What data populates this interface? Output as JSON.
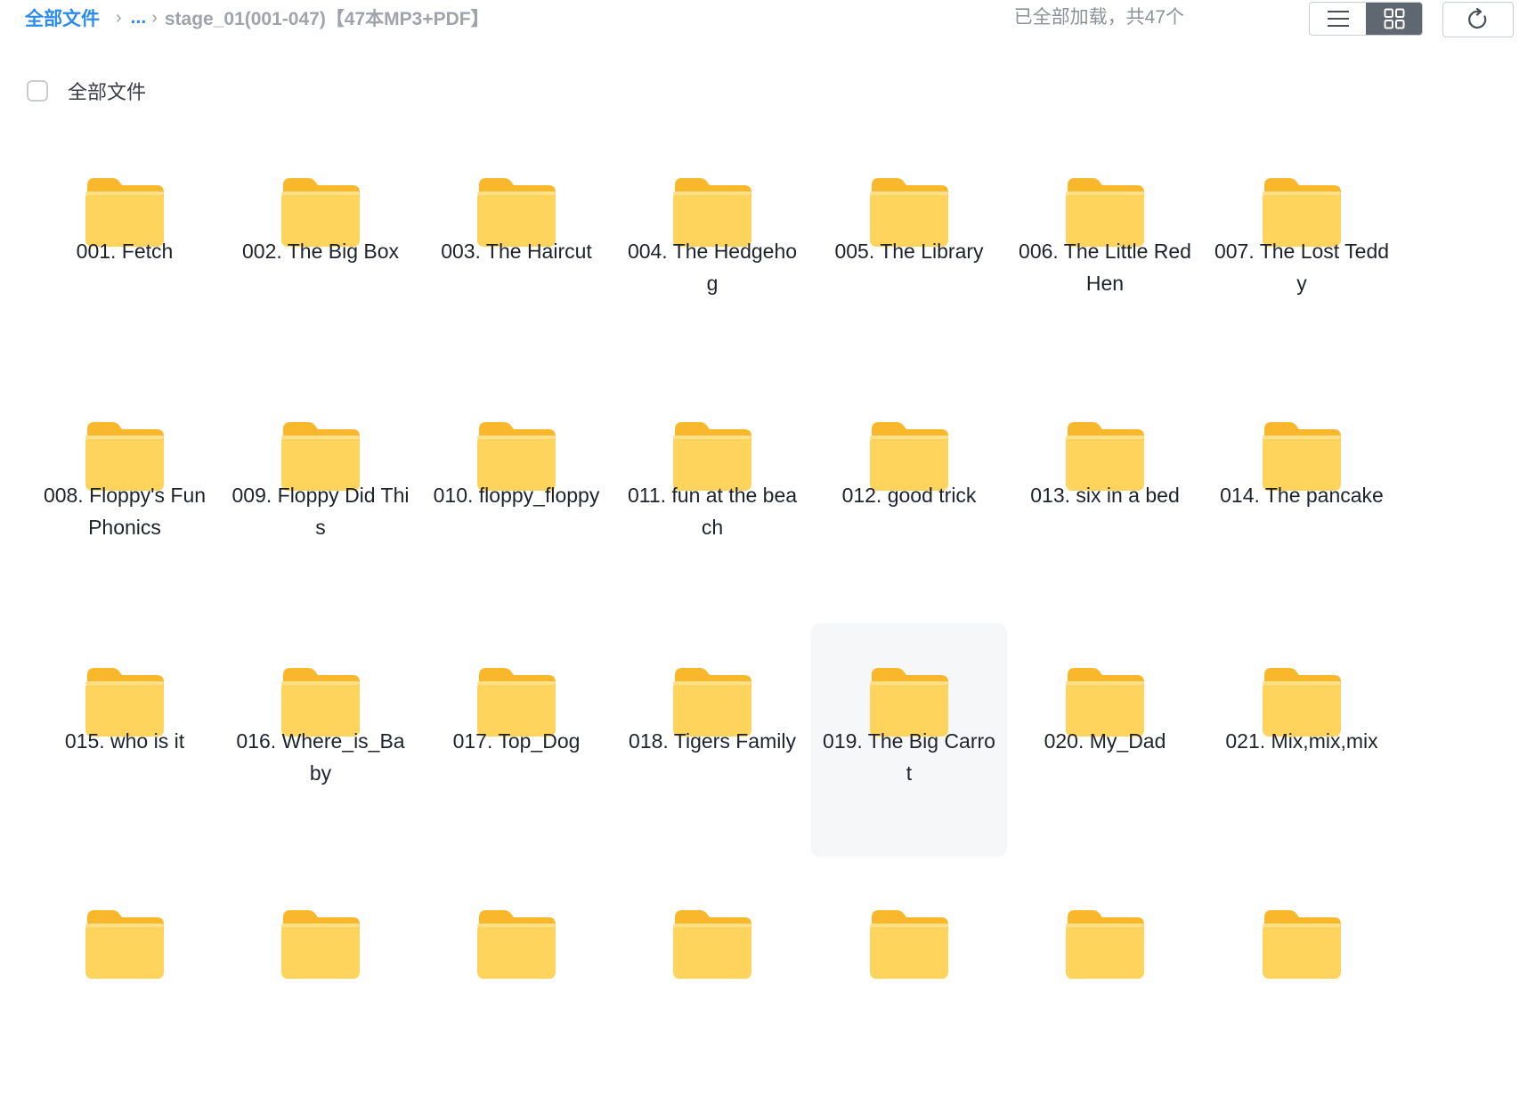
{
  "breadcrumb": {
    "root": "全部文件",
    "ellipsis": "...",
    "current": "stage_01(001-047)【47本MP3+PDF】"
  },
  "status": {
    "text": "已全部加载，共47个"
  },
  "view": {
    "mode": "grid"
  },
  "select_all": {
    "label": "全部文件",
    "checked": false
  },
  "colors": {
    "accent": "#2b8cf0",
    "folder_back": "#f9b82c",
    "folder_front": "#ffd45c",
    "hover_bg": "#f6f7f9"
  },
  "files": [
    {
      "name": "001. Fetch",
      "icon": "folder-icon"
    },
    {
      "name": "002. The Big Box",
      "icon": "folder-icon"
    },
    {
      "name": "003. The Haircut",
      "icon": "folder-icon"
    },
    {
      "name": "004. The Hedgehog",
      "icon": "folder-icon"
    },
    {
      "name": "005. The Library",
      "icon": "folder-icon"
    },
    {
      "name": "006. The Little Red Hen",
      "icon": "folder-icon"
    },
    {
      "name": "007. The Lost Teddy",
      "icon": "folder-icon"
    },
    {
      "name": "008. Floppy's Fun Phonics",
      "icon": "folder-icon"
    },
    {
      "name": "009. Floppy Did This",
      "icon": "folder-icon"
    },
    {
      "name": "010. floppy_floppy",
      "icon": "folder-icon"
    },
    {
      "name": "011. fun at the beach",
      "icon": "folder-icon"
    },
    {
      "name": "012. good trick",
      "icon": "folder-icon"
    },
    {
      "name": "013. six in a bed",
      "icon": "folder-icon"
    },
    {
      "name": "014. The pancake",
      "icon": "folder-icon"
    },
    {
      "name": "015. who is it",
      "icon": "folder-icon"
    },
    {
      "name": "016. Where_is_Baby",
      "icon": "folder-icon"
    },
    {
      "name": "017. Top_Dog",
      "icon": "folder-icon"
    },
    {
      "name": "018. Tigers Family",
      "icon": "folder-icon"
    },
    {
      "name": "019. The Big Carrot",
      "icon": "folder-icon",
      "hover": true
    },
    {
      "name": "020. My_Dad",
      "icon": "folder-icon"
    },
    {
      "name": "021. Mix,mix,mix",
      "icon": "folder-icon"
    },
    {
      "name": "",
      "icon": "folder-icon"
    },
    {
      "name": "",
      "icon": "folder-icon"
    },
    {
      "name": "",
      "icon": "folder-icon"
    },
    {
      "name": "",
      "icon": "folder-icon"
    },
    {
      "name": "",
      "icon": "folder-icon"
    },
    {
      "name": "",
      "icon": "folder-icon"
    },
    {
      "name": "",
      "icon": "folder-icon"
    }
  ]
}
